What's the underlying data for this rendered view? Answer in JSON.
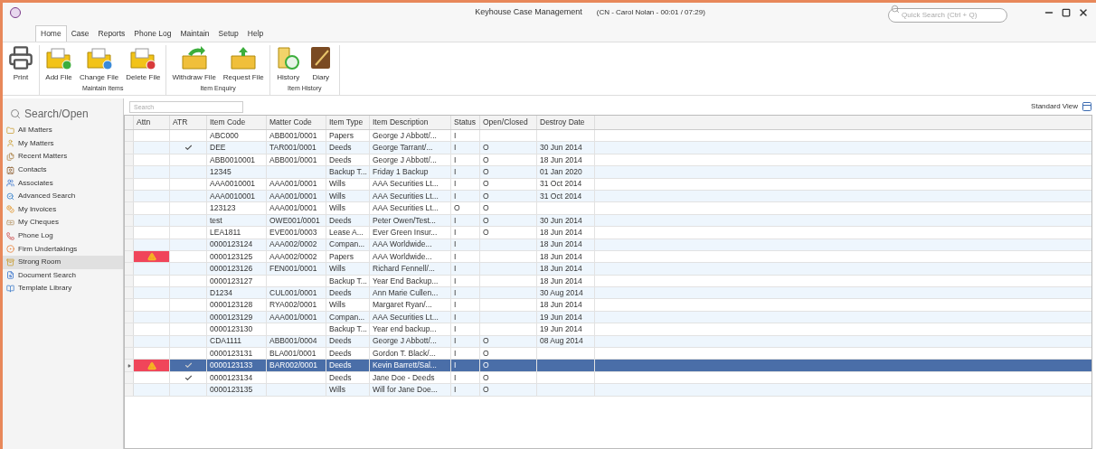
{
  "window": {
    "title": "Keyhouse Case Management",
    "subtitle": "(CN - Carol Nolan - 00:01 / 07:29)"
  },
  "quick_search": {
    "placeholder": "Quick Search (Ctrl + Q)"
  },
  "menu_tabs": [
    {
      "label": "Home",
      "selected": true
    },
    {
      "label": "Case",
      "selected": false
    },
    {
      "label": "Reports",
      "selected": false
    },
    {
      "label": "Phone Log",
      "selected": false
    },
    {
      "label": "Maintain",
      "selected": false
    },
    {
      "label": "Setup",
      "selected": false
    },
    {
      "label": "Help",
      "selected": false
    }
  ],
  "ribbon_groups": [
    {
      "buttons": [
        "Print"
      ]
    },
    {
      "label": "Maintain Items",
      "buttons": [
        "Add File",
        "Change File",
        "Delete File"
      ]
    },
    {
      "label": "Item Enquiry",
      "buttons": [
        "Withdraw File",
        "Request File"
      ]
    },
    {
      "label": "Item History",
      "buttons": [
        "History",
        "Diary"
      ]
    }
  ],
  "sidebar": {
    "title": "Search/Open",
    "items": [
      {
        "label": "All Matters",
        "selected": false
      },
      {
        "label": "My Matters",
        "selected": false
      },
      {
        "label": "Recent Matters",
        "selected": false
      },
      {
        "label": "Contacts",
        "selected": false
      },
      {
        "label": "Associates",
        "selected": false
      },
      {
        "label": "Advanced Search",
        "selected": false
      },
      {
        "label": "My Invoices",
        "selected": false
      },
      {
        "label": "My Cheques",
        "selected": false
      },
      {
        "label": "Phone Log",
        "selected": false
      },
      {
        "label": "Firm Undertakings",
        "selected": false
      },
      {
        "label": "Strong Room",
        "selected": true
      },
      {
        "label": "Document Search",
        "selected": false
      },
      {
        "label": "Template Library",
        "selected": false
      }
    ]
  },
  "grid": {
    "search": {
      "placeholder": "Search"
    },
    "view_label": "Standard View",
    "columns": [
      "Attn",
      "ATR",
      "Item Code",
      "Matter Code",
      "Item Type",
      "Item Description",
      "Status",
      "Open/Closed",
      "Destroy Date"
    ],
    "rows": [
      {
        "attn": false,
        "atr": false,
        "selected": false,
        "cells": [
          "",
          "",
          "ABC000",
          "ABB001/0001",
          "Papers",
          "George J Abbott/...",
          "I",
          "",
          ""
        ]
      },
      {
        "attn": false,
        "atr": true,
        "selected": false,
        "cells": [
          "",
          "",
          "DEE",
          "TAR001/0001",
          "Deeds",
          "George Tarrant/...",
          "I",
          "O",
          "30 Jun 2014"
        ]
      },
      {
        "attn": false,
        "atr": false,
        "selected": false,
        "cells": [
          "",
          "",
          "ABB0010001",
          "ABB001/0001",
          "Deeds",
          "George J Abbott/...",
          "I",
          "O",
          "18 Jun 2014"
        ]
      },
      {
        "attn": false,
        "atr": false,
        "selected": false,
        "cells": [
          "",
          "",
          "12345",
          "",
          "Backup T...",
          "Friday 1 Backup",
          "I",
          "O",
          "01 Jan 2020"
        ]
      },
      {
        "attn": false,
        "atr": false,
        "selected": false,
        "cells": [
          "",
          "",
          "AAA0010001",
          "AAA001/0001",
          "Wills",
          "AAA Securities Lt...",
          "I",
          "O",
          "31 Oct 2014"
        ]
      },
      {
        "attn": false,
        "atr": false,
        "selected": false,
        "cells": [
          "",
          "",
          "AAA0010001",
          "AAA001/0001",
          "Wills",
          "AAA Securities Lt...",
          "I",
          "O",
          "31 Oct 2014"
        ]
      },
      {
        "attn": false,
        "atr": false,
        "selected": false,
        "cells": [
          "",
          "",
          "123123",
          "AAA001/0001",
          "Wills",
          "AAA Securities Lt...",
          "O",
          "O",
          ""
        ]
      },
      {
        "attn": false,
        "atr": false,
        "selected": false,
        "cells": [
          "",
          "",
          "test",
          "OWE001/0001",
          "Deeds",
          "Peter Owen/Test...",
          "I",
          "O",
          "30 Jun 2014"
        ]
      },
      {
        "attn": false,
        "atr": false,
        "selected": false,
        "cells": [
          "",
          "",
          "LEA1811",
          "EVE001/0003",
          "Lease A...",
          "Ever Green Insur...",
          "I",
          "O",
          "18 Jun 2014"
        ]
      },
      {
        "attn": false,
        "atr": false,
        "selected": false,
        "cells": [
          "",
          "",
          "0000123124",
          "AAA002/0002",
          "Compan...",
          "AAA Worldwide...",
          "I",
          "",
          "18 Jun 2014"
        ]
      },
      {
        "attn": true,
        "atr": false,
        "selected": false,
        "cells": [
          "",
          "",
          "0000123125",
          "AAA002/0002",
          "Papers",
          "AAA Worldwide...",
          "I",
          "",
          "18 Jun 2014"
        ]
      },
      {
        "attn": false,
        "atr": false,
        "selected": false,
        "cells": [
          "",
          "",
          "0000123126",
          "FEN001/0001",
          "Wills",
          "Richard Fennell/...",
          "I",
          "",
          "18 Jun 2014"
        ]
      },
      {
        "attn": false,
        "atr": false,
        "selected": false,
        "cells": [
          "",
          "",
          "0000123127",
          "",
          "Backup T...",
          "Year End Backup...",
          "I",
          "",
          "18 Jun 2014"
        ]
      },
      {
        "attn": false,
        "atr": false,
        "selected": false,
        "cells": [
          "",
          "",
          "D1234",
          "CUL001/0001",
          "Deeds",
          "Ann Marie Cullen...",
          "I",
          "",
          "30 Aug 2014"
        ]
      },
      {
        "attn": false,
        "atr": false,
        "selected": false,
        "cells": [
          "",
          "",
          "0000123128",
          "RYA002/0001",
          "Wills",
          "Margaret Ryan/...",
          "I",
          "",
          "18 Jun 2014"
        ]
      },
      {
        "attn": false,
        "atr": false,
        "selected": false,
        "cells": [
          "",
          "",
          "0000123129",
          "AAA001/0001",
          "Compan...",
          "AAA Securities Lt...",
          "I",
          "",
          "19 Jun 2014"
        ]
      },
      {
        "attn": false,
        "atr": false,
        "selected": false,
        "cells": [
          "",
          "",
          "0000123130",
          "",
          "Backup T...",
          "Year end backup...",
          "I",
          "",
          "19 Jun 2014"
        ]
      },
      {
        "attn": false,
        "atr": false,
        "selected": false,
        "cells": [
          "",
          "",
          "CDA1111",
          "ABB001/0004",
          "Deeds",
          "George J Abbott/...",
          "I",
          "O",
          "08 Aug 2014"
        ]
      },
      {
        "attn": false,
        "atr": false,
        "selected": false,
        "cells": [
          "",
          "",
          "0000123131",
          "BLA001/0001",
          "Deeds",
          "Gordon T. Black/...",
          "I",
          "O",
          ""
        ]
      },
      {
        "attn": true,
        "atr": true,
        "selected": true,
        "cells": [
          "",
          "",
          "0000123133",
          "BAR002/0001",
          "Deeds",
          "Kevin Barrett/Sal...",
          "I",
          "O",
          ""
        ]
      },
      {
        "attn": false,
        "atr": true,
        "selected": false,
        "cells": [
          "",
          "",
          "0000123134",
          "",
          "Deeds",
          "Jane Doe - Deeds",
          "I",
          "O",
          ""
        ]
      },
      {
        "attn": false,
        "atr": false,
        "selected": false,
        "cells": [
          "",
          "",
          "0000123135",
          "",
          "Wills",
          "Will for Jane Doe...",
          "I",
          "O",
          ""
        ]
      }
    ]
  }
}
